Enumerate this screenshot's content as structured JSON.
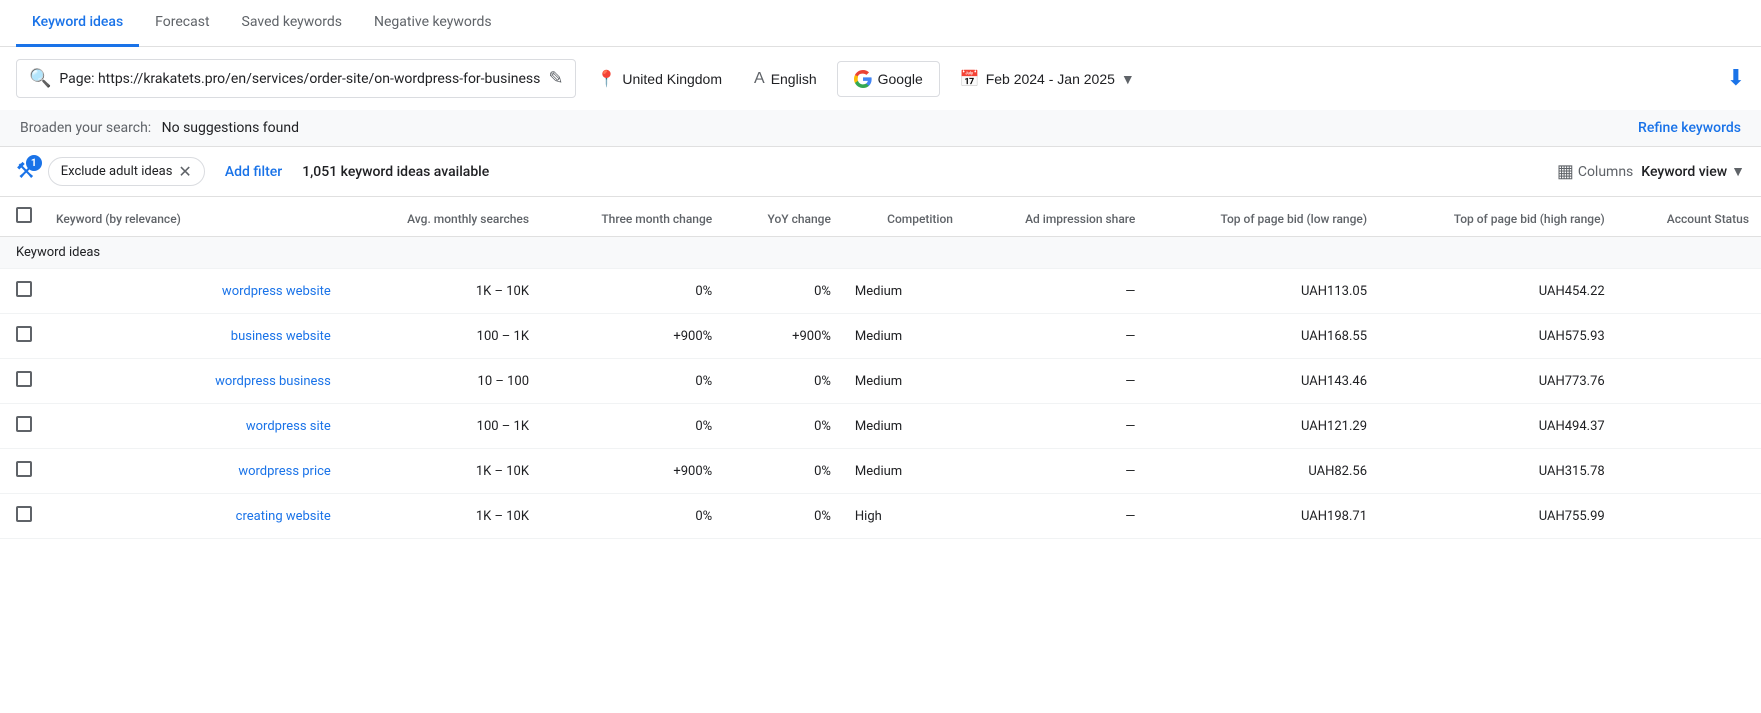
{
  "tabs": [
    {
      "id": "keyword-ideas",
      "label": "Keyword ideas",
      "active": true
    },
    {
      "id": "forecast",
      "label": "Forecast",
      "active": false
    },
    {
      "id": "saved-keywords",
      "label": "Saved keywords",
      "active": false
    },
    {
      "id": "negative-keywords",
      "label": "Negative keywords",
      "active": false
    }
  ],
  "toolbar": {
    "search_url": "Page: https://krakatets.pro/en/services/order-site/on-wordpress-for-business",
    "location": "United Kingdom",
    "language": "English",
    "network": "Google",
    "date_range": "Feb 2024 - Jan 2025",
    "download_tooltip": "Download"
  },
  "broaden": {
    "label": "Broaden your search:",
    "value": "No suggestions found",
    "refine_label": "Refine keywords"
  },
  "filter_bar": {
    "filter_badge": "1",
    "chip_label": "Exclude adult ideas",
    "add_filter_label": "Add filter",
    "keyword_count": "1,051 keyword ideas available",
    "columns_label": "Columns",
    "view_label": "Keyword view"
  },
  "table": {
    "headers": [
      {
        "id": "keyword",
        "label": "Keyword (by relevance)"
      },
      {
        "id": "avg-monthly",
        "label": "Avg. monthly searches"
      },
      {
        "id": "three-month",
        "label": "Three month change"
      },
      {
        "id": "yoy",
        "label": "YoY change"
      },
      {
        "id": "competition",
        "label": "Competition"
      },
      {
        "id": "ad-impression",
        "label": "Ad impression share"
      },
      {
        "id": "top-bid-low",
        "label": "Top of page bid (low range)"
      },
      {
        "id": "top-bid-high",
        "label": "Top of page bid (high range)"
      },
      {
        "id": "account-status",
        "label": "Account Status"
      }
    ],
    "section_label": "Keyword ideas",
    "rows": [
      {
        "keyword": "wordpress website",
        "avg_monthly": "1K – 10K",
        "three_month": "0%",
        "yoy": "0%",
        "competition": "Medium",
        "ad_impression": "—",
        "top_bid_low": "UAH113.05",
        "top_bid_high": "UAH454.22",
        "account_status": ""
      },
      {
        "keyword": "business website",
        "avg_monthly": "100 – 1K",
        "three_month": "+900%",
        "yoy": "+900%",
        "competition": "Medium",
        "ad_impression": "—",
        "top_bid_low": "UAH168.55",
        "top_bid_high": "UAH575.93",
        "account_status": ""
      },
      {
        "keyword": "wordpress business",
        "avg_monthly": "10 – 100",
        "three_month": "0%",
        "yoy": "0%",
        "competition": "Medium",
        "ad_impression": "—",
        "top_bid_low": "UAH143.46",
        "top_bid_high": "UAH773.76",
        "account_status": ""
      },
      {
        "keyword": "wordpress site",
        "avg_monthly": "100 – 1K",
        "three_month": "0%",
        "yoy": "0%",
        "competition": "Medium",
        "ad_impression": "—",
        "top_bid_low": "UAH121.29",
        "top_bid_high": "UAH494.37",
        "account_status": ""
      },
      {
        "keyword": "wordpress price",
        "avg_monthly": "1K – 10K",
        "three_month": "+900%",
        "yoy": "0%",
        "competition": "Medium",
        "ad_impression": "—",
        "top_bid_low": "UAH82.56",
        "top_bid_high": "UAH315.78",
        "account_status": ""
      },
      {
        "keyword": "creating website",
        "avg_monthly": "1K – 10K",
        "three_month": "0%",
        "yoy": "0%",
        "competition": "High",
        "ad_impression": "—",
        "top_bid_low": "UAH198.71",
        "top_bid_high": "UAH755.99",
        "account_status": ""
      }
    ]
  }
}
